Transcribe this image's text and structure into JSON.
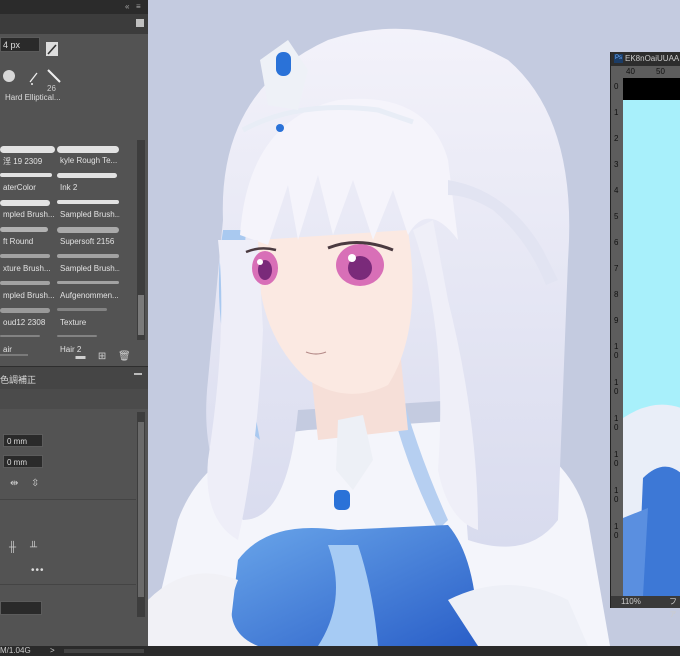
{
  "toolbar": {
    "collapse_icon": "«",
    "close_icon": "≡"
  },
  "brush_panel": {
    "size_value": "4 px",
    "tip_size_number": "26",
    "tip_name": "Hard Elliptical...",
    "presets": [
      {
        "label": "淫 19 2309"
      },
      {
        "label": "kyle Rough Te..."
      },
      {
        "label": "aterColor"
      },
      {
        "label": "Ink 2"
      },
      {
        "label": "mpled Brush..."
      },
      {
        "label": "Sampled Brush..."
      },
      {
        "label": "ft Round"
      },
      {
        "label": "Supersoft 2156"
      },
      {
        "label": "xture Brush..."
      },
      {
        "label": "Sampled Brush..."
      },
      {
        "label": "mpled Brush..."
      },
      {
        "label": "Aufgenommen..."
      },
      {
        "label": "oud12 2308"
      },
      {
        "label": "Texture"
      },
      {
        "label": "air"
      },
      {
        "label": "Hair 2"
      }
    ]
  },
  "properties_panel": {
    "tab_label": "色調補正",
    "field_1": "0 mm",
    "field_2": "0 mm",
    "more_label": "•••"
  },
  "doc2": {
    "title": "EK8nOaiUUAA",
    "ruler_h_labels": [
      "40",
      "50"
    ],
    "ruler_v_labels": [
      "0",
      "1",
      "2",
      "3",
      "4",
      "5",
      "6",
      "7",
      "8",
      "9",
      "1\n0",
      "1\n0",
      "1\n0",
      "1\n0",
      "1\n0",
      "1\n0"
    ],
    "zoom": "110%",
    "status_label": "ファ"
  },
  "status_bar": {
    "doc_size": "M/1.04G",
    "arrow": ">"
  },
  "colors": {
    "panel_bg": "#535353",
    "canvas_bg": "#c4cbe0",
    "doc2_bg": "#a8f0fb",
    "accent_blue": "#2a6fd6"
  }
}
